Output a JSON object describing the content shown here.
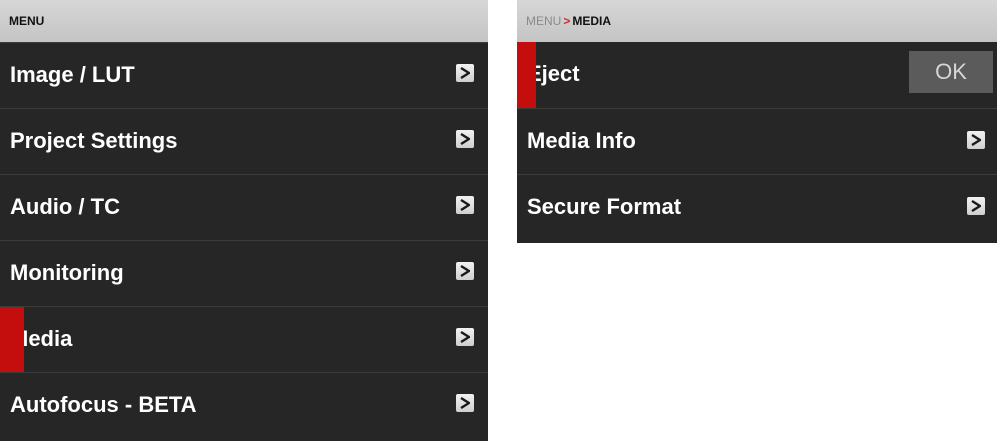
{
  "left_menu": {
    "header": "MENU",
    "items": [
      {
        "label": "Image / LUT"
      },
      {
        "label": "Project Settings"
      },
      {
        "label": "Audio / TC"
      },
      {
        "label": "Monitoring"
      },
      {
        "label": "Media",
        "selected": true
      },
      {
        "label": "Autofocus - BETA"
      }
    ]
  },
  "right_menu": {
    "breadcrumb": {
      "parent": "MENU",
      "separator": ">",
      "current": "MEDIA"
    },
    "items": [
      {
        "label": "Eject",
        "selected": true,
        "action_label": "OK"
      },
      {
        "label": "Media Info"
      },
      {
        "label": "Secure Format"
      }
    ]
  },
  "colors": {
    "panel_bg": "#262626",
    "header_bg": "#cfcfcf",
    "selection_accent": "#c40d0d",
    "ok_button_bg": "#5b5b5b"
  },
  "icons": {
    "submenu": "chevron-right-icon"
  }
}
